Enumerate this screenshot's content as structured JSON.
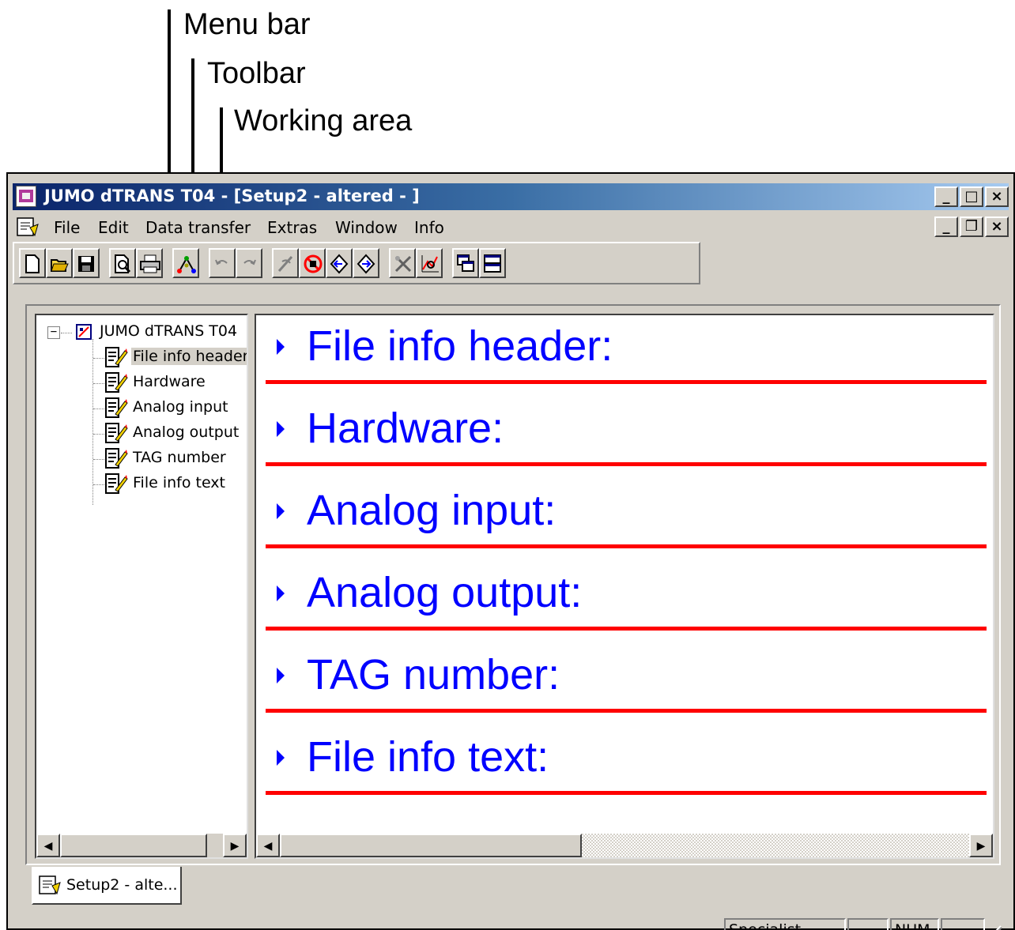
{
  "callouts": {
    "menu_bar": "Menu bar",
    "toolbar": "Toolbar",
    "working_area": "Working area"
  },
  "window": {
    "title": "JUMO dTRANS T04 - [Setup2 - altered - ]"
  },
  "menu": {
    "items": [
      "File",
      "Edit",
      "Data transfer",
      "Extras",
      "Window",
      "Info"
    ]
  },
  "tree": {
    "root": "JUMO dTRANS T04",
    "items": [
      "File info header",
      "Hardware",
      "Analog input",
      "Analog output",
      "TAG number",
      "File info text"
    ],
    "selected": "File info header"
  },
  "content": {
    "sections": [
      "File info header:",
      "Hardware:",
      "Analog input:",
      "Analog output:",
      "TAG number:",
      "File info text:"
    ]
  },
  "doc_tab": {
    "label": "Setup2 - alte..."
  },
  "status": {
    "mode": "Specialist",
    "num": "NUM"
  },
  "colors": {
    "section_title": "#0000ff",
    "section_rule": "#ff0000",
    "titlebar_start": "#0a246a",
    "chrome": "#d4d0c8"
  },
  "icons": {
    "toolbar": [
      "new-file-icon",
      "open-folder-icon",
      "save-icon",
      "print-preview-icon",
      "print-icon",
      "network-icon",
      "undo-icon",
      "redo-icon",
      "link-icon",
      "disconnect-icon",
      "read-device-icon",
      "write-device-icon",
      "tools-icon",
      "chart-search-icon",
      "cascade-windows-icon",
      "tile-windows-icon"
    ]
  }
}
